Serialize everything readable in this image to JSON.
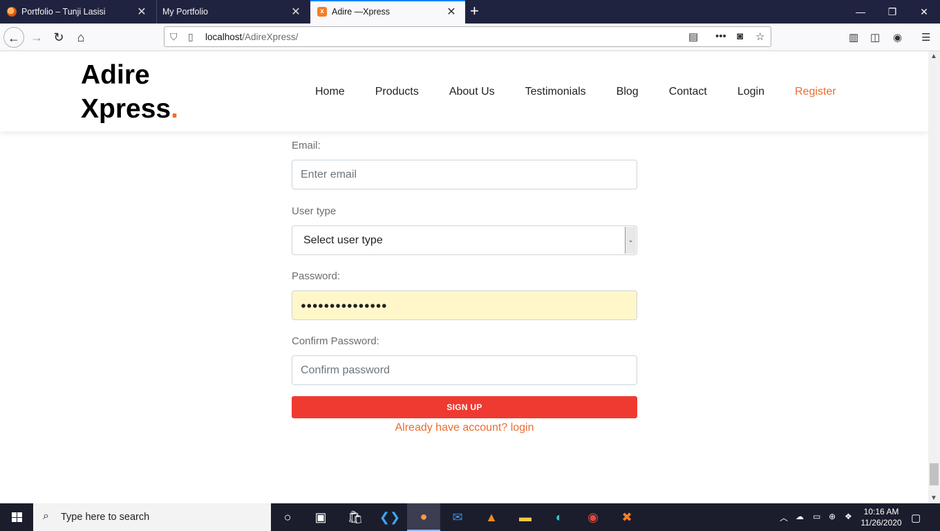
{
  "browser": {
    "tabs": [
      {
        "title": "Portfolio – Tunji Lasisi"
      },
      {
        "title": "My Portfolio"
      },
      {
        "title": "Adire —Xpress"
      }
    ],
    "url_host": "localhost",
    "url_path": "/AdireXpress/"
  },
  "site": {
    "logo_line1": "Adire",
    "logo_line2": "Xpress",
    "logo_dot": ".",
    "nav": [
      "Home",
      "Products",
      "About Us",
      "Testimonials",
      "Blog",
      "Contact",
      "Login",
      "Register"
    ],
    "accent_color": "#ed6b2e"
  },
  "form": {
    "email_label": "Email:",
    "email_placeholder": "Enter email",
    "usertype_label": "User type",
    "usertype_selected": "Select user type",
    "password_label": "Password:",
    "password_value": "●●●●●●●●●●●●●●●",
    "confirm_label": "Confirm Password:",
    "confirm_placeholder": "Confirm password",
    "signup_label": "SIGN UP",
    "login_link": "Already have account? login",
    "button_color": "#ef3a31"
  },
  "taskbar": {
    "search_placeholder": "Type here to search",
    "time": "10:16 AM",
    "date": "11/26/2020"
  }
}
